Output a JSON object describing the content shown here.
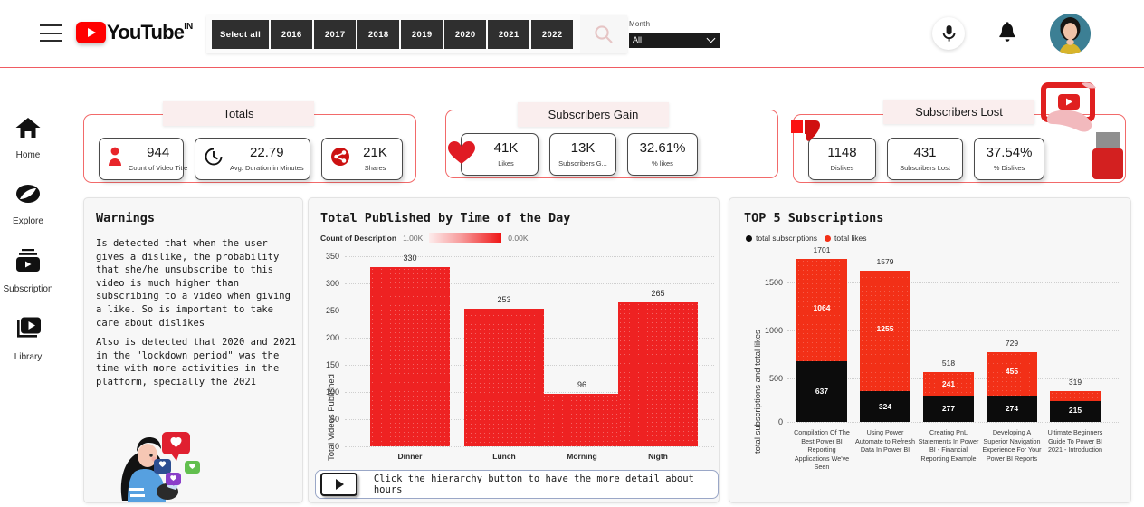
{
  "header": {
    "brand_name": "YouTube",
    "brand_sup": "IN",
    "menu_icon": "hamburger-icon",
    "play_icon": "youtube-play-icon",
    "search_icon": "magnifier-icon",
    "mic_icon": "microphone-icon",
    "bell_icon": "notification-bell-icon",
    "avatar_icon": "user-avatar",
    "year_filter": {
      "buttons": [
        "Select all",
        "2016",
        "2017",
        "2018",
        "2019",
        "2020",
        "2021",
        "2022"
      ]
    },
    "month_filter": {
      "label": "Month",
      "value": "All",
      "options": [
        "All"
      ],
      "chevron_icon": "chevron-down-icon"
    }
  },
  "sidebar": {
    "items": [
      {
        "label": "Home",
        "icon": "home-icon"
      },
      {
        "label": "Explore",
        "icon": "compass-icon"
      },
      {
        "label": "Subscription",
        "icon": "subscription-icon"
      },
      {
        "label": "Library",
        "icon": "library-icon"
      }
    ]
  },
  "kpi_groups": [
    {
      "title": "Totals",
      "cards": [
        {
          "value": "944",
          "label": "Count of Video Title",
          "icon": "person-icon"
        },
        {
          "value": "22.79",
          "label": "Avg. Duration in Minutes",
          "icon": "clock-icon"
        },
        {
          "value": "21K",
          "label": "Shares",
          "icon": "share-icon"
        }
      ]
    },
    {
      "title": "Subscribers Gain",
      "cards": [
        {
          "value": "41K",
          "label": "Likes",
          "icon": "heart-icon"
        },
        {
          "value": "13K",
          "label": "Subscribers G...",
          "icon": ""
        },
        {
          "value": "32.61%",
          "label": "% likes",
          "icon": ""
        }
      ]
    },
    {
      "title": "Subscribers Lost",
      "cards": [
        {
          "value": "1148",
          "label": "Dislikes",
          "icon": "thumbs-down-icon"
        },
        {
          "value": "431",
          "label": "Subscribers Lost",
          "icon": ""
        },
        {
          "value": "37.54%",
          "label": "% Dislikes",
          "icon": ""
        }
      ]
    }
  ],
  "warnings": {
    "title": "Warnings",
    "paragraph1": "Is detected that when the user\ngives a dislike, the probability\nthat she/he unsubscribe to this\nvideo is much higher than\nsubscribing to a video when giving\na like. So is important to take\ncare about dislikes",
    "paragraph2": "Also is detected that 2020 and 2021\nin the \"lockdown period\" was the\ntime with more activities in the\nplatform, specially the 2021",
    "illustration": "woman-with-phone-likes-illustration"
  },
  "hint": {
    "text": "Click the hierarchy button to  have the more  detail about hours",
    "button_icon": "hierarchy-play-button"
  },
  "chart_data": [
    {
      "type": "bar",
      "title": "Total Published by Time of the Day",
      "legend_label": "Count of Description",
      "legend_max": "1.00K",
      "legend_min": "0.00K",
      "xlabel": "",
      "ylabel": "Total Videos Published",
      "categories": [
        "Dinner",
        "Lunch",
        "Morning",
        "Nigth"
      ],
      "values": [
        330,
        253,
        96,
        265
      ],
      "ylim": [
        0,
        350
      ],
      "yticks": [
        0,
        50,
        100,
        150,
        200,
        250,
        300,
        350
      ],
      "grid": true,
      "bar_color": "#ee2222"
    },
    {
      "type": "bar",
      "subtype": "stacked",
      "title": "TOP 5 Subscriptions",
      "xlabel": "",
      "ylabel": "total subscriptions and total likes",
      "legend": [
        {
          "name": "total subscriptions",
          "color": "#0c0c0c"
        },
        {
          "name": "total likes",
          "color": "#f23017"
        }
      ],
      "categories": [
        "Compilation Of The Best Power BI Reporting Applications We've Seen",
        "Using Power Automate to Refresh Data In Power BI",
        "Creating PnL Statements In Power BI - Financial Reporting Example",
        "Developing A Superior Navigation Experience For Your Power BI Reports",
        "Ultimate Beginners Guide To Power BI 2021 - Introduction"
      ],
      "series": [
        {
          "name": "total subscriptions",
          "values": [
            637,
            324,
            277,
            274,
            215
          ]
        },
        {
          "name": "total likes",
          "values": [
            1064,
            1255,
            241,
            455,
            104
          ]
        }
      ],
      "totals": [
        1701,
        1579,
        518,
        729,
        319
      ],
      "ylim": [
        0,
        1800
      ],
      "yticks": [
        0,
        500,
        1000,
        1500
      ],
      "grid": true
    }
  ]
}
